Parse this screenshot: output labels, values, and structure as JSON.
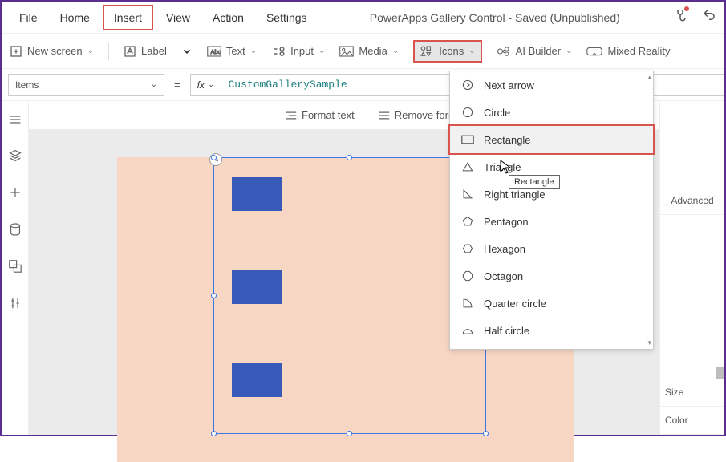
{
  "menu": {
    "file": "File",
    "home": "Home",
    "insert": "Insert",
    "view": "View",
    "action": "Action",
    "settings": "Settings"
  },
  "app_title": "PowerApps Gallery Control - Saved (Unpublished)",
  "toolbar": {
    "new_screen": "New screen",
    "label": "Label",
    "text": "Text",
    "input": "Input",
    "media": "Media",
    "icons": "Icons",
    "ai_builder": "AI Builder",
    "mixed_reality": "Mixed Reality"
  },
  "formula": {
    "prop": "Items",
    "fx": "fx",
    "value": "CustomGallerySample"
  },
  "format_bar": {
    "format_text": "Format text",
    "remove_format": "Remove format"
  },
  "dropdown": {
    "items": [
      "Next arrow",
      "Circle",
      "Rectangle",
      "Triangle",
      "Right triangle",
      "Pentagon",
      "Hexagon",
      "Octagon",
      "Quarter circle",
      "Half circle"
    ],
    "hover_index": 2,
    "tooltip": "Rectangle"
  },
  "right_panel": {
    "advanced": "Advanced",
    "size": "Size",
    "color": "Color"
  }
}
